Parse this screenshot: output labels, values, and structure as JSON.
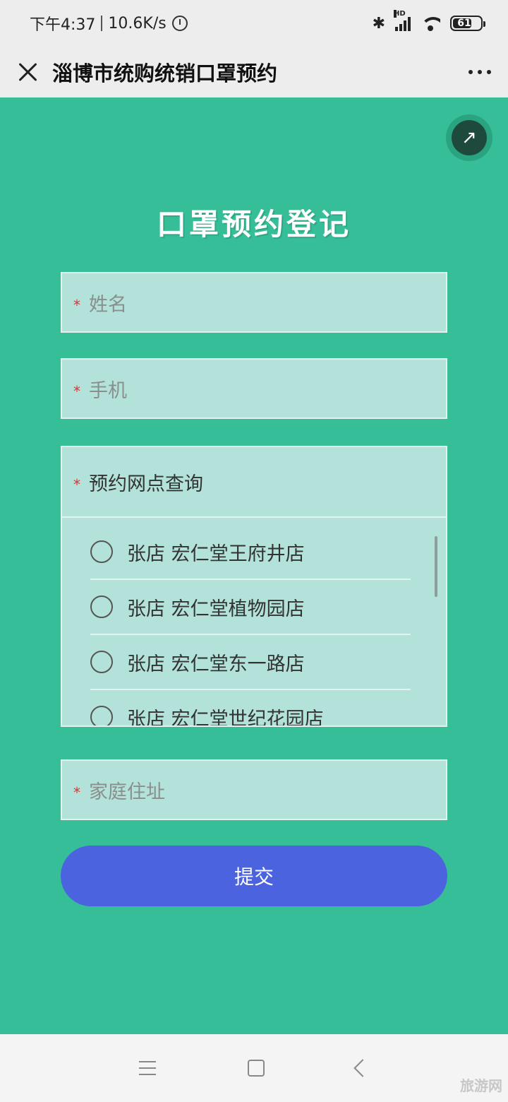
{
  "status_bar": {
    "time": "下午4:37",
    "network_speed": "10.6K/s",
    "battery": "61",
    "signal_label": "HD"
  },
  "title_bar": {
    "title": "淄博市统购统销口罩预约"
  },
  "form": {
    "heading": "口罩预约登记",
    "required_mark": "*",
    "name_placeholder": "姓名",
    "phone_placeholder": "手机",
    "outlet_label": "预约网点查询",
    "outlets": [
      "张店 宏仁堂王府井店",
      "张店 宏仁堂植物园店",
      "张店 宏仁堂东一路店",
      "张店 宏仁堂世纪花园店"
    ],
    "address_placeholder": "家庭住址",
    "submit_label": "提交"
  },
  "watermark": "旅游网"
}
